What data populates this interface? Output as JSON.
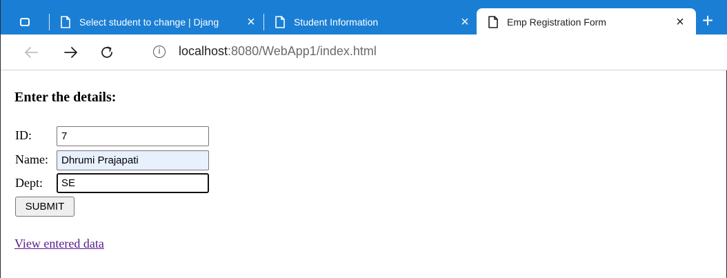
{
  "browser": {
    "tabs": [
      {
        "title": "Select student to change | Djang"
      },
      {
        "title": "Student Information"
      },
      {
        "title": "Emp Registration Form",
        "active": true
      }
    ],
    "close_glyph": "×",
    "new_tab_glyph": "+",
    "address": {
      "host": "localhost",
      "path": ":8080/WebApp1/index.html"
    },
    "colors": {
      "tab_strip": "#1a7fd4",
      "visited_link": "#551a8b",
      "autofill": "#e8f0fe"
    }
  },
  "page": {
    "heading": "Enter the details:",
    "fields": {
      "id": {
        "label": "ID:",
        "value": "7"
      },
      "name": {
        "label": "Name:",
        "value": "Dhrumi Prajapati"
      },
      "dept": {
        "label": "Dept:",
        "value": "SE"
      }
    },
    "submit_label": "SUBMIT",
    "link_text": "View entered data"
  }
}
